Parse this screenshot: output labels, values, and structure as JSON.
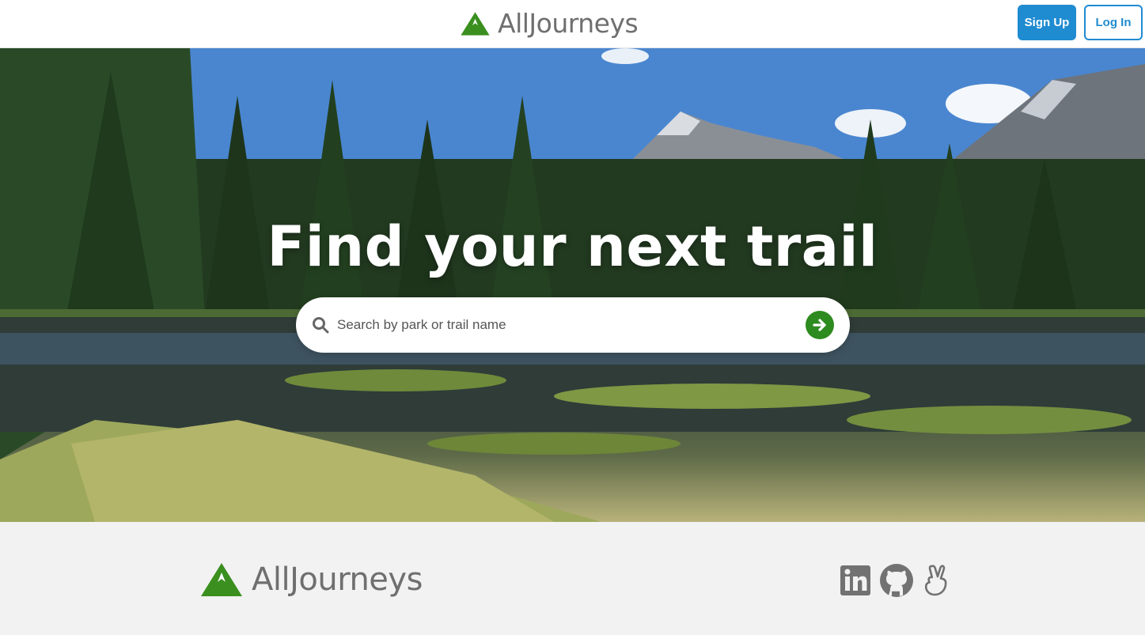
{
  "header": {
    "brand_name": "AllJourneys",
    "signup_label": "Sign Up",
    "login_label": "Log In"
  },
  "hero": {
    "title": "Find your next trail",
    "search": {
      "placeholder": "Search by park or trail name",
      "value": ""
    }
  },
  "footer": {
    "brand_name": "AllJourneys",
    "social": [
      "linkedin-icon",
      "github-icon",
      "angellist-icon"
    ]
  },
  "colors": {
    "brand_green": "#3a8f1e",
    "accent_blue": "#1f8bd1",
    "brand_text": "#6f6f6f",
    "footer_bg": "#f2f2f2"
  }
}
